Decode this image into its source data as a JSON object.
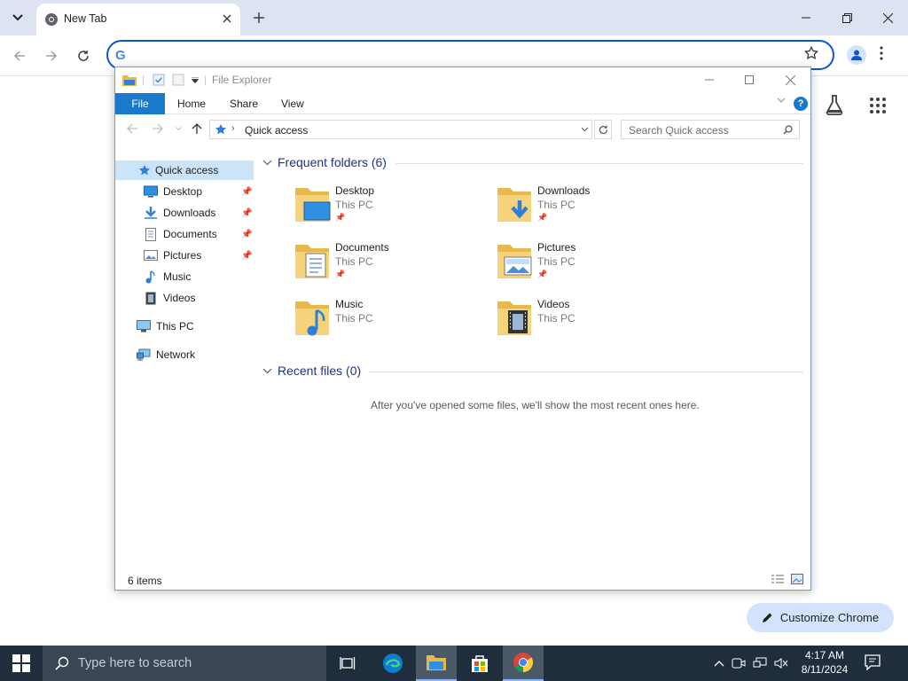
{
  "browser": {
    "tab_title": "New Tab",
    "omnibox_value": "",
    "customize_label": "Customize Chrome"
  },
  "explorer": {
    "title": "File Explorer",
    "ribbon_tabs": [
      "File",
      "Home",
      "Share",
      "View"
    ],
    "address": "Quick access",
    "search_placeholder": "Search Quick access",
    "nav": {
      "quick_access": "Quick access",
      "pinned": [
        "Desktop",
        "Downloads",
        "Documents",
        "Pictures"
      ],
      "unpinned": [
        "Music",
        "Videos"
      ],
      "this_pc": "This PC",
      "network": "Network"
    },
    "frequent_header": "Frequent folders (6)",
    "folders": [
      {
        "name": "Desktop",
        "location": "This PC",
        "pinned": true
      },
      {
        "name": "Downloads",
        "location": "This PC",
        "pinned": true
      },
      {
        "name": "Documents",
        "location": "This PC",
        "pinned": true
      },
      {
        "name": "Pictures",
        "location": "This PC",
        "pinned": true
      },
      {
        "name": "Music",
        "location": "This PC",
        "pinned": false
      },
      {
        "name": "Videos",
        "location": "This PC",
        "pinned": false
      }
    ],
    "recent_header": "Recent files (0)",
    "recent_empty": "After you've opened some files, we'll show the most recent ones here.",
    "status": "6 items"
  },
  "taskbar": {
    "search_placeholder": "Type here to search",
    "time": "4:17 AM",
    "date": "8/11/2024"
  },
  "colors": {
    "accent": "#1979ca",
    "chrome_frame": "#dee3f2",
    "taskbar": "#1f2d3d",
    "omnibox_border": "#0b57d0"
  }
}
